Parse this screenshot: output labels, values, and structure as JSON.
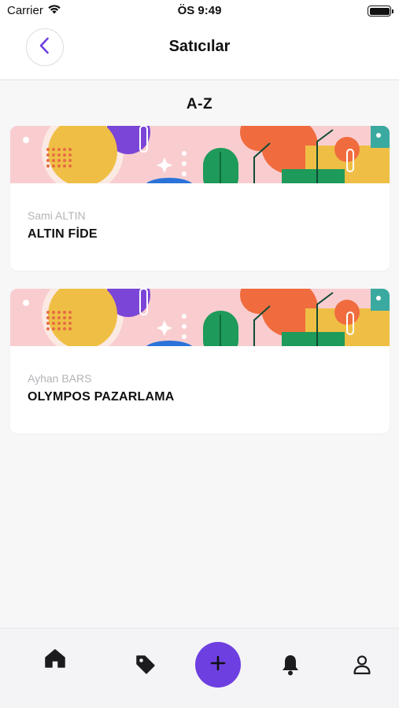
{
  "status_bar": {
    "carrier": "Carrier",
    "time": "ÖS 9:49"
  },
  "header": {
    "title": "Satıcılar",
    "back_icon": "chevron-left-icon"
  },
  "section_header": "A-Z",
  "sellers": [
    {
      "owner": "Sami ALTIN",
      "company": "ALTIN FİDE"
    },
    {
      "owner": "Ayhan BARS",
      "company": "OLYMPOS PAZARLAMA"
    }
  ],
  "tab_bar": {
    "items": [
      "home-icon",
      "tag-icon",
      "plus-icon",
      "bell-icon",
      "user-icon"
    ],
    "fab_color": "#6e3fe0"
  },
  "colors": {
    "accent": "#6e3fe0",
    "muted_text": "#b4b4b9",
    "background": "#f7f7f8"
  }
}
